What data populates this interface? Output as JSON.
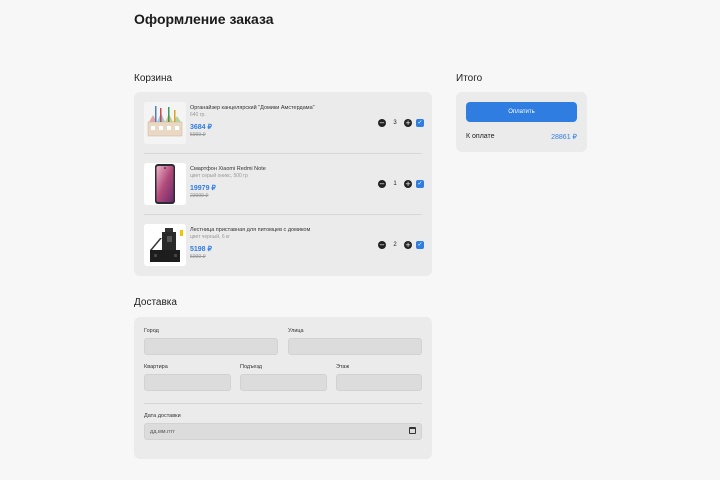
{
  "page": {
    "title": "Оформление заказа"
  },
  "cart": {
    "title": "Корзина",
    "items": [
      {
        "name": "Органайзер канцелярский \"Домики Амстердама\"",
        "sub": "640 гр.",
        "price": "3684 ₽",
        "old_price": "5999 ₽",
        "qty": "3",
        "image": "organizer-image"
      },
      {
        "name": "Смартфон Xiaomi Redmi Note",
        "sub": "цвет серый оникс, 500 гр",
        "price": "19979 ₽",
        "old_price": "23999 ₽",
        "qty": "1",
        "image": "smartphone-image"
      },
      {
        "name": "Лестница приставная для питомцев с домиком",
        "sub": "цвет черный, 6 кг",
        "price": "5198 ₽",
        "old_price": "5999 ₽",
        "qty": "2",
        "image": "pet-ladder-image"
      }
    ],
    "minus": "−",
    "plus": "+",
    "checkmark": "✓"
  },
  "total": {
    "title": "Итого",
    "pay_label": "Оплатить",
    "due_label": "К оплате",
    "due_value": "28861 ₽"
  },
  "delivery": {
    "title": "Доставка",
    "city_label": "Город",
    "street_label": "Улица",
    "apartment_label": "Квартира",
    "entrance_label": "Подъезд",
    "floor_label": "Этаж",
    "date_label": "Дата доставки",
    "date_placeholder": "дд.мм.гггг"
  },
  "colors": {
    "accent": "#2f7de1",
    "panel": "#ebebeb",
    "background": "#f7f7f7"
  }
}
